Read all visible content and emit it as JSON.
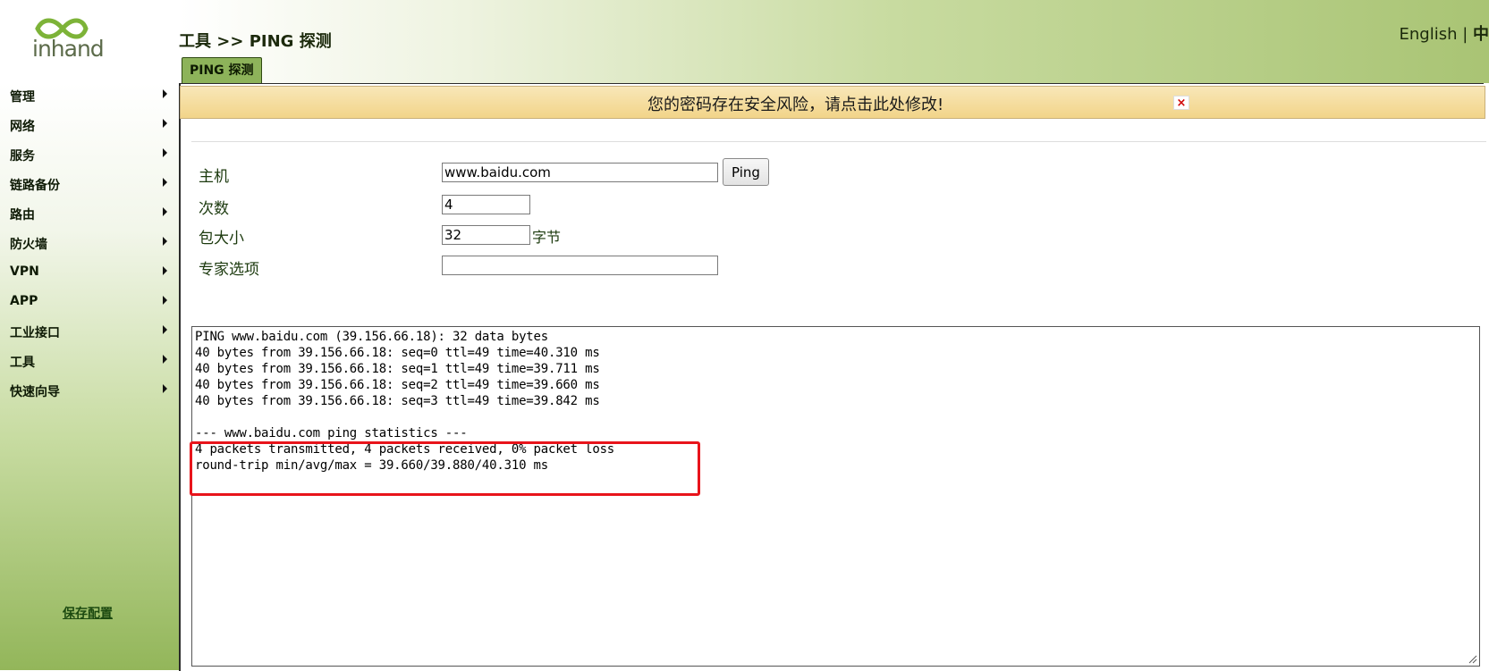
{
  "header": {
    "logo_text": "inhand",
    "breadcrumb": "工具 >> PING 探测",
    "lang_en": "English",
    "lang_sep": " | ",
    "lang_cn": "中",
    "tab": "PING 探测"
  },
  "sidebar": {
    "items": [
      {
        "label": "管理"
      },
      {
        "label": "网络"
      },
      {
        "label": "服务"
      },
      {
        "label": "链路备份"
      },
      {
        "label": "路由"
      },
      {
        "label": "防火墙"
      },
      {
        "label": "VPN"
      },
      {
        "label": "APP"
      },
      {
        "label": "工业接口"
      },
      {
        "label": "工具"
      },
      {
        "label": "快速向导"
      }
    ],
    "save_label": "保存配置"
  },
  "warning": {
    "text": "您的密码存在安全风险，请点击此处修改!",
    "close": "×"
  },
  "form": {
    "host_label": "主机",
    "host_value": "www.baidu.com",
    "ping_button": "Ping",
    "count_label": "次数",
    "count_value": "4",
    "size_label": "包大小",
    "size_value": "32",
    "size_unit": "字节",
    "expert_label": "专家选项",
    "expert_value": ""
  },
  "output": {
    "lines": [
      "PING www.baidu.com (39.156.66.18): 32 data bytes",
      "40 bytes from 39.156.66.18: seq=0 ttl=49 time=40.310 ms",
      "40 bytes from 39.156.66.18: seq=1 ttl=49 time=39.711 ms",
      "40 bytes from 39.156.66.18: seq=2 ttl=49 time=39.660 ms",
      "40 bytes from 39.156.66.18: seq=3 ttl=49 time=39.842 ms",
      "",
      "--- www.baidu.com ping statistics ---",
      "4 packets transmitted, 4 packets received, 0% packet loss",
      "round-trip min/avg/max = 39.660/39.880/40.310 ms"
    ]
  },
  "colors": {
    "highlight": "#e8141b",
    "accent_green": "#8db35a",
    "warning_bg": "#f2d489"
  }
}
